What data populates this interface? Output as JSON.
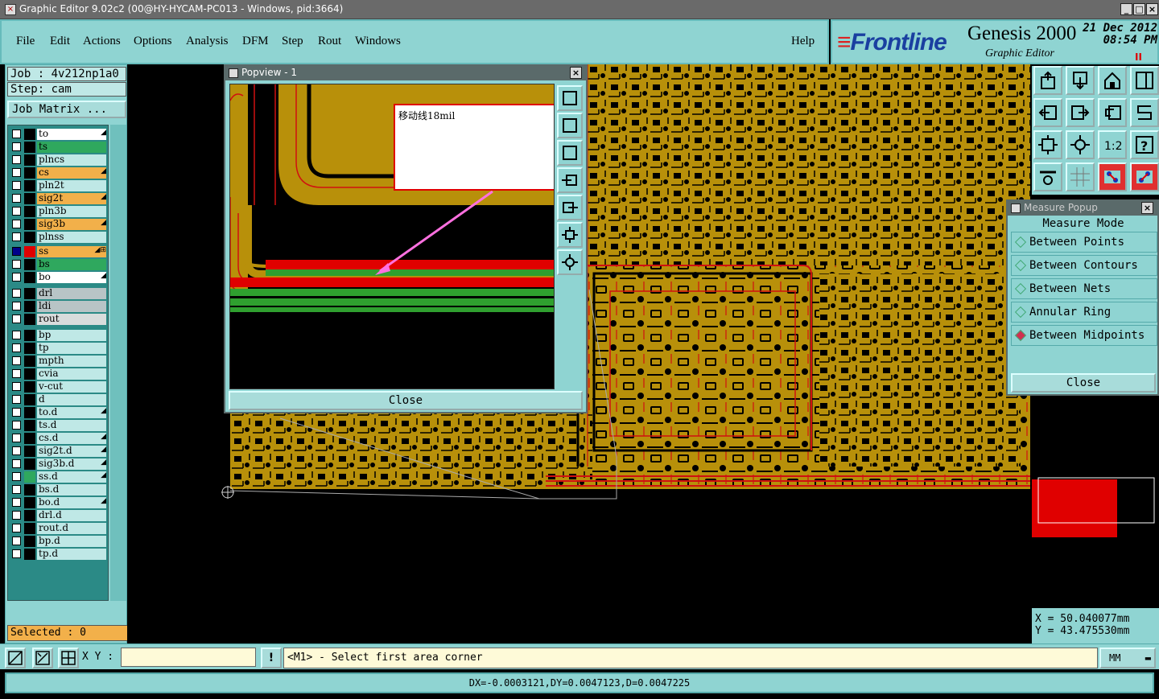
{
  "window": {
    "title": "Graphic Editor 9.02c2 (00@HY-HYCAM-PC013 - Windows, pid:3664)",
    "min_label": "_",
    "max_label": "□",
    "close_label": "×"
  },
  "menu": {
    "items": [
      "File",
      "Edit",
      "Actions",
      "Options",
      "Analysis",
      "DFM",
      "Step",
      "Rout",
      "Windows"
    ],
    "help": "Help"
  },
  "brand": {
    "logo_bars": "≡",
    "logo": "Frontline",
    "product": "Genesis 2000",
    "subtitle": "Graphic Editor",
    "date": "21 Dec 2012",
    "time": "08:54 PM",
    "pause_icon": "II"
  },
  "left": {
    "job": "Job : 4v212np1a0",
    "step": "Step: cam",
    "job_matrix": "Job Matrix ...",
    "selected": "Selected : 0"
  },
  "layers": [
    {
      "name": "to",
      "bg": "white",
      "mark": "◢"
    },
    {
      "name": "ts",
      "bg": "green",
      "mark": ""
    },
    {
      "name": "plncs",
      "bg": "none",
      "mark": ""
    },
    {
      "name": "cs",
      "bg": "orange",
      "mark": "◢"
    },
    {
      "name": "pln2t",
      "bg": "none",
      "mark": ""
    },
    {
      "name": "sig2t",
      "bg": "orange",
      "mark": "◢"
    },
    {
      "name": "pln3b",
      "bg": "none",
      "mark": ""
    },
    {
      "name": "sig3b",
      "bg": "orange",
      "mark": "◢"
    },
    {
      "name": "plnss",
      "bg": "none",
      "mark": ""
    },
    {
      "name": "ss",
      "bg": "orange",
      "mark": "◢⊞",
      "checked": true,
      "swatch": "#e00000"
    },
    {
      "name": "bs",
      "bg": "green",
      "mark": ""
    },
    {
      "name": "bo",
      "bg": "white",
      "mark": "◢"
    },
    {
      "name": "drl",
      "bg": "grey",
      "mark": ""
    },
    {
      "name": "ldi",
      "bg": "grey",
      "mark": ""
    },
    {
      "name": "rout",
      "bg": "lgrey",
      "mark": ""
    },
    {
      "name": "bp",
      "bg": "none",
      "mark": ""
    },
    {
      "name": "tp",
      "bg": "none",
      "mark": ""
    },
    {
      "name": "mpth",
      "bg": "none",
      "mark": ""
    },
    {
      "name": "cvia",
      "bg": "none",
      "mark": ""
    },
    {
      "name": "v-cut",
      "bg": "none",
      "mark": ""
    },
    {
      "name": "d",
      "bg": "none",
      "mark": ""
    },
    {
      "name": "to.d",
      "bg": "none",
      "mark": "◢"
    },
    {
      "name": "ts.d",
      "bg": "none",
      "mark": ""
    },
    {
      "name": "cs.d",
      "bg": "none",
      "mark": "◢"
    },
    {
      "name": "sig2t.d",
      "bg": "none",
      "mark": "◢"
    },
    {
      "name": "sig3b.d",
      "bg": "none",
      "mark": "◢"
    },
    {
      "name": "ss.d",
      "bg": "none",
      "mark": "◢",
      "swatch": "#2fa85e"
    },
    {
      "name": "bs.d",
      "bg": "none",
      "mark": ""
    },
    {
      "name": "bo.d",
      "bg": "none",
      "mark": "◢"
    },
    {
      "name": "drl.d",
      "bg": "none",
      "mark": ""
    },
    {
      "name": "rout.d",
      "bg": "none",
      "mark": ""
    },
    {
      "name": "bp.d",
      "bg": "none",
      "mark": ""
    },
    {
      "name": "tp.d",
      "bg": "none",
      "mark": ""
    }
  ],
  "popview": {
    "title": "Popview - 1",
    "note": "移动线18mil",
    "close": "Close",
    "close_icon": "×"
  },
  "measure": {
    "title": "Measure Popup",
    "header": "Measure Mode",
    "options": [
      "Between Points",
      "Between Contours",
      "Between Nets",
      "Annular Ring",
      "Between Midpoints"
    ],
    "selected_index": 4,
    "close": "Close",
    "close_icon": "×"
  },
  "coords": {
    "x": "X  =  50.040077mm",
    "y": "Y  =  43.475530mm"
  },
  "bottom": {
    "xy_label": "X Y :",
    "xy_value": "",
    "warn_icon": "!",
    "prompt": "<M1> - Select first area corner",
    "units": "MM",
    "status": "DX=-0.0003121,DY=0.0047123,D=0.0047225"
  },
  "colors": {
    "panel": "#8fd4d2",
    "copper": "#b8900a",
    "trace_red": "#e00000",
    "trace_green": "#2fa02f",
    "arrow": "#ff70e0"
  }
}
